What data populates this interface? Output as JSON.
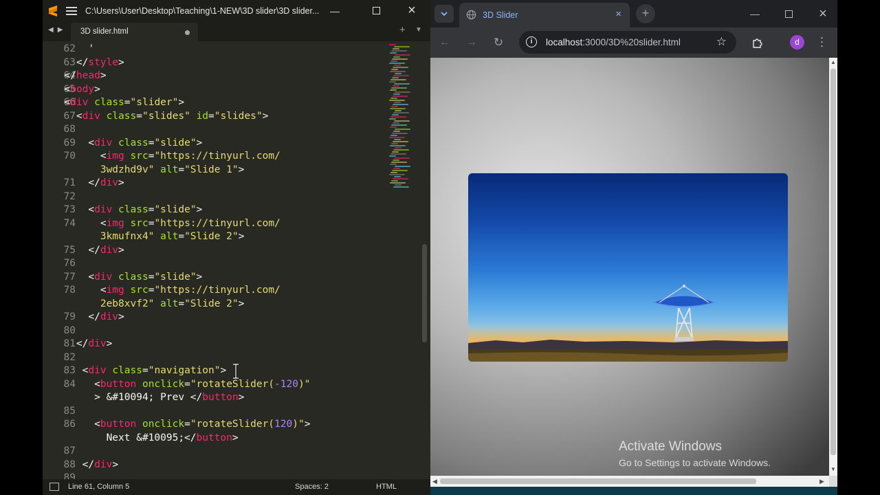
{
  "editor": {
    "title": "C:\\Users\\User\\Desktop\\Teaching\\1-NEW\\3D slider\\3D slider...",
    "tab_label": "3D slider.html",
    "status": {
      "position": "Line 61, Column 5",
      "spaces": "Spaces: 2",
      "syntax": "HTML"
    },
    "line_numbers": [
      "62",
      "63",
      "64",
      "65",
      "66",
      "67",
      "68",
      "69",
      "70",
      "",
      "71",
      "72",
      "73",
      "74",
      "",
      "75",
      "76",
      "77",
      "78",
      "",
      "79",
      "80",
      "81",
      "82",
      "83",
      "84",
      "",
      "85",
      "86",
      "",
      "87",
      "88",
      "89"
    ],
    "lines": [
      [
        [
          "pn",
          "      '"
        ]
      ],
      [
        [
          "pn",
          "    </"
        ],
        [
          "tg",
          "style"
        ],
        [
          "pn",
          ">"
        ]
      ],
      [
        [
          "pn",
          "  </"
        ],
        [
          "tg",
          "head"
        ],
        [
          "pn",
          ">"
        ]
      ],
      [
        [
          "pn",
          "  <"
        ],
        [
          "tg",
          "body"
        ],
        [
          "pn",
          ">"
        ]
      ],
      [
        [
          "pn",
          "  <"
        ],
        [
          "tg",
          "div"
        ],
        [
          "pn",
          " "
        ],
        [
          "at",
          "class"
        ],
        [
          "pn",
          "="
        ],
        [
          "st",
          "\"slider\""
        ],
        [
          "pn",
          ">"
        ]
      ],
      [
        [
          "pn",
          "    <"
        ],
        [
          "tg",
          "div"
        ],
        [
          "pn",
          " "
        ],
        [
          "at",
          "class"
        ],
        [
          "pn",
          "="
        ],
        [
          "st",
          "\"slides\""
        ],
        [
          "pn",
          " "
        ],
        [
          "at",
          "id"
        ],
        [
          "pn",
          "="
        ],
        [
          "st",
          "\"slides\""
        ],
        [
          "pn",
          ">"
        ]
      ],
      [],
      [
        [
          "pn",
          "      <"
        ],
        [
          "tg",
          "div"
        ],
        [
          "pn",
          " "
        ],
        [
          "at",
          "class"
        ],
        [
          "pn",
          "="
        ],
        [
          "st",
          "\"slide\""
        ],
        [
          "pn",
          ">"
        ]
      ],
      [
        [
          "pn",
          "        <"
        ],
        [
          "tg",
          "img"
        ],
        [
          "pn",
          " "
        ],
        [
          "at",
          "src"
        ],
        [
          "pn",
          "="
        ],
        [
          "st",
          "\"https://tinyurl.com/"
        ]
      ],
      [
        [
          "st",
          "        3wdzhd9v\""
        ],
        [
          "pn",
          " "
        ],
        [
          "at",
          "alt"
        ],
        [
          "pn",
          "="
        ],
        [
          "st",
          "\"Slide 1\""
        ],
        [
          "pn",
          ">"
        ]
      ],
      [
        [
          "pn",
          "      </"
        ],
        [
          "tg",
          "div"
        ],
        [
          "pn",
          ">"
        ]
      ],
      [],
      [
        [
          "pn",
          "      <"
        ],
        [
          "tg",
          "div"
        ],
        [
          "pn",
          " "
        ],
        [
          "at",
          "class"
        ],
        [
          "pn",
          "="
        ],
        [
          "st",
          "\"slide\""
        ],
        [
          "pn",
          ">"
        ]
      ],
      [
        [
          "pn",
          "        <"
        ],
        [
          "tg",
          "img"
        ],
        [
          "pn",
          " "
        ],
        [
          "at",
          "src"
        ],
        [
          "pn",
          "="
        ],
        [
          "st",
          "\"https://tinyurl.com/"
        ]
      ],
      [
        [
          "st",
          "        3kmufnx4\""
        ],
        [
          "pn",
          " "
        ],
        [
          "at",
          "alt"
        ],
        [
          "pn",
          "="
        ],
        [
          "st",
          "\"Slide 2\""
        ],
        [
          "pn",
          ">"
        ]
      ],
      [
        [
          "pn",
          "      </"
        ],
        [
          "tg",
          "div"
        ],
        [
          "pn",
          ">"
        ]
      ],
      [],
      [
        [
          "pn",
          "      <"
        ],
        [
          "tg",
          "div"
        ],
        [
          "pn",
          " "
        ],
        [
          "at",
          "class"
        ],
        [
          "pn",
          "="
        ],
        [
          "st",
          "\"slide\""
        ],
        [
          "pn",
          ">"
        ]
      ],
      [
        [
          "pn",
          "        <"
        ],
        [
          "tg",
          "img"
        ],
        [
          "pn",
          " "
        ],
        [
          "at",
          "src"
        ],
        [
          "pn",
          "="
        ],
        [
          "st",
          "\"https://tinyurl.com/"
        ]
      ],
      [
        [
          "st",
          "        2eb8xvf2\""
        ],
        [
          "pn",
          " "
        ],
        [
          "at",
          "alt"
        ],
        [
          "pn",
          "="
        ],
        [
          "st",
          "\"Slide 2\""
        ],
        [
          "pn",
          ">"
        ]
      ],
      [
        [
          "pn",
          "      </"
        ],
        [
          "tg",
          "div"
        ],
        [
          "pn",
          ">"
        ]
      ],
      [],
      [
        [
          "pn",
          "    </"
        ],
        [
          "tg",
          "div"
        ],
        [
          "pn",
          ">"
        ]
      ],
      [],
      [
        [
          "pn",
          "     <"
        ],
        [
          "tg",
          "div"
        ],
        [
          "pn",
          " "
        ],
        [
          "at",
          "class"
        ],
        [
          "pn",
          "="
        ],
        [
          "st",
          "\"navigation\""
        ],
        [
          "pn",
          ">"
        ]
      ],
      [
        [
          "pn",
          "       <"
        ],
        [
          "tg",
          "button"
        ],
        [
          "pn",
          " "
        ],
        [
          "at",
          "onclick"
        ],
        [
          "pn",
          "="
        ],
        [
          "st",
          "\"rotateSlider("
        ],
        [
          "nm",
          "-120"
        ],
        [
          "st",
          ")\""
        ]
      ],
      [
        [
          "pn",
          "       > &#10094; Prev </"
        ],
        [
          "tg",
          "button"
        ],
        [
          "pn",
          ">"
        ]
      ],
      [],
      [
        [
          "pn",
          "       <"
        ],
        [
          "tg",
          "button"
        ],
        [
          "pn",
          " "
        ],
        [
          "at",
          "onclick"
        ],
        [
          "pn",
          "="
        ],
        [
          "st",
          "\"rotateSlider("
        ],
        [
          "nm",
          "120"
        ],
        [
          "st",
          ")\""
        ],
        [
          "pn",
          ">"
        ]
      ],
      [
        [
          "pn",
          "         Next &#10095;</"
        ],
        [
          "tg",
          "button"
        ],
        [
          "pn",
          ">"
        ]
      ],
      [],
      [
        [
          "pn",
          "     </"
        ],
        [
          "tg",
          "div"
        ],
        [
          "pn",
          ">"
        ]
      ],
      []
    ]
  },
  "browser": {
    "tab_title": "3D Slider",
    "url_host": "localhost",
    "url_rest": ":3000/3D%20slider.html",
    "profile_initial": "d"
  },
  "watermark": {
    "title": "Activate Windows",
    "subtitle": "Go to Settings to activate Windows."
  },
  "colors": {
    "editor_bg": "#282923",
    "tag": "#f92672",
    "attr": "#a6e22e",
    "string": "#e6db74",
    "number": "#ae81ff",
    "browser_chrome": "#35363a"
  }
}
